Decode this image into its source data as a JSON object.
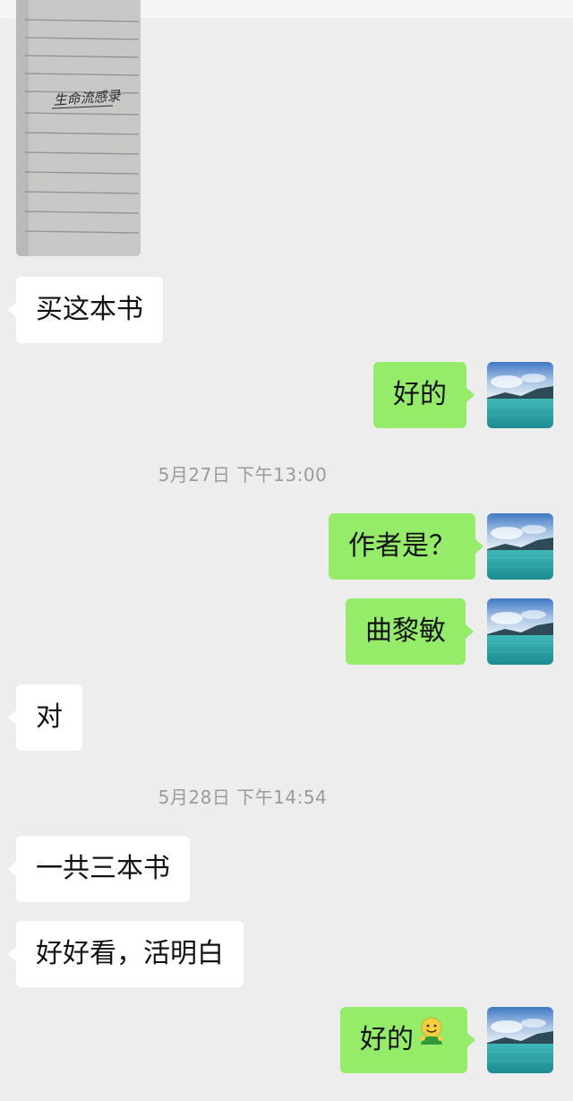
{
  "conversation": {
    "timestamps": [
      "5月27日 下午13:00",
      "5月28日 下午14:54"
    ],
    "messages": [
      {
        "id": "m1",
        "side": "incoming",
        "type": "image",
        "caption": "生命流感录"
      },
      {
        "id": "m2",
        "side": "incoming",
        "text": "买这本书"
      },
      {
        "id": "m3",
        "side": "outgoing",
        "text": "好的"
      },
      {
        "id": "m4",
        "side": "outgoing",
        "text": "作者是？"
      },
      {
        "id": "m5",
        "side": "outgoing",
        "text": "曲黎敏"
      },
      {
        "id": "m6",
        "side": "incoming",
        "text": "对"
      },
      {
        "id": "m7",
        "side": "incoming",
        "text": "一共三本书"
      },
      {
        "id": "m8",
        "side": "incoming",
        "text": "好好看，活明白"
      },
      {
        "id": "m9",
        "side": "outgoing",
        "text": "好的",
        "emoji": "smiling-face-emoji"
      }
    ]
  },
  "colors": {
    "background": "#ededed",
    "outgoing_bubble": "#95ec69",
    "incoming_bubble": "#ffffff",
    "timestamp_text": "#9b9b9b"
  },
  "avatar": {
    "icon": "lake-landscape-avatar"
  }
}
